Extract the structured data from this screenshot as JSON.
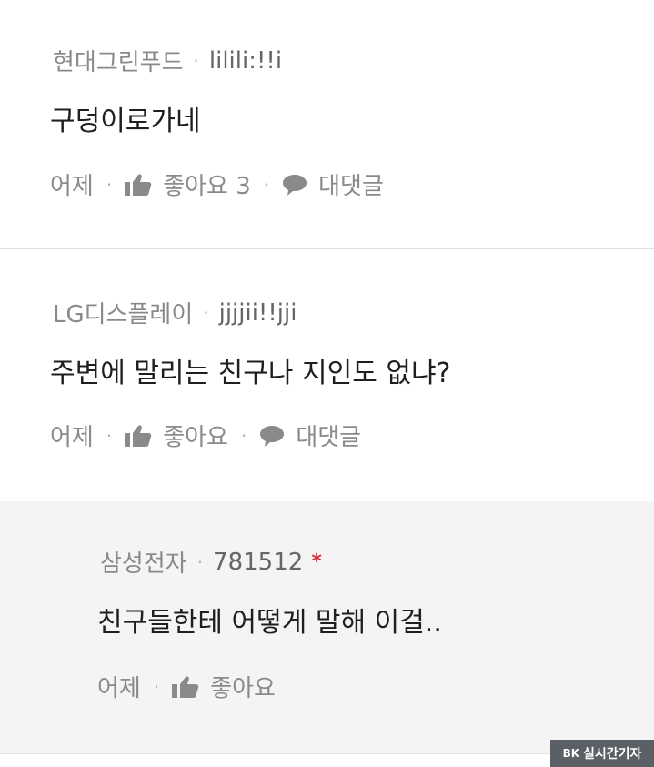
{
  "comments": [
    {
      "company": "현대그린푸드",
      "user_id": "lilili:!!i",
      "text": "구덩이로가네",
      "time": "어제",
      "like_label": "좋아요 3",
      "reply_label": "대댓글"
    },
    {
      "company": "LG디스플레이",
      "user_id": "jjjjii!!jji",
      "text": "주변에 말리는 친구나 지인도 없냐?",
      "time": "어제",
      "like_label": "좋아요",
      "reply_label": "대댓글"
    },
    {
      "company": "삼성전자",
      "user_id": "781512",
      "author_marker": "*",
      "text": "친구들한테 어떻게 말해 이걸..",
      "time": "어제",
      "like_label": "좋아요"
    }
  ],
  "separator": "·",
  "icons": {
    "like": "thumbs-up-icon",
    "reply": "speech-bubble-icon"
  },
  "watermark": {
    "logo": "BK",
    "text": "실시간기자"
  },
  "colors": {
    "meta_gray": "#8a8a8a",
    "text": "#1f1f1f",
    "author_star": "#d0303a",
    "reply_bg": "#f4f4f5"
  }
}
